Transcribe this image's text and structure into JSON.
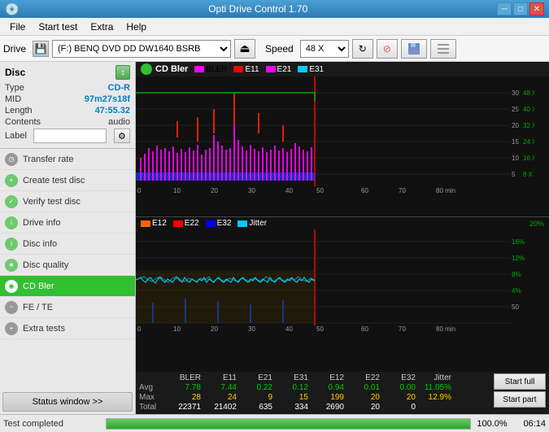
{
  "titleBar": {
    "title": "Opti Drive Control 1.70",
    "icon": "💿",
    "minBtn": "─",
    "maxBtn": "□",
    "closeBtn": "✕"
  },
  "menuBar": {
    "items": [
      "File",
      "Start test",
      "Extra",
      "Help"
    ]
  },
  "toolbar": {
    "driveLabel": "Drive",
    "driveValue": "(F:)  BENQ DVD DD DW1640 BSRB",
    "speedLabel": "Speed",
    "speedValue": "48 X"
  },
  "sidebar": {
    "discTitle": "Disc",
    "discInfo": [
      {
        "key": "Type",
        "value": "CD-R"
      },
      {
        "key": "MID",
        "value": "97m27s18f"
      },
      {
        "key": "Length",
        "value": "47:55.32"
      },
      {
        "key": "Contents",
        "value": "audio"
      },
      {
        "key": "Label",
        "value": ""
      }
    ],
    "navItems": [
      {
        "label": "Transfer rate",
        "active": false
      },
      {
        "label": "Create test disc",
        "active": false
      },
      {
        "label": "Verify test disc",
        "active": false
      },
      {
        "label": "Drive info",
        "active": false
      },
      {
        "label": "Disc info",
        "active": false
      },
      {
        "label": "Disc quality",
        "active": false
      },
      {
        "label": "CD Bler",
        "active": true
      },
      {
        "label": "FE / TE",
        "active": false
      },
      {
        "label": "Extra tests",
        "active": false
      }
    ],
    "statusWindowBtn": "Status window >>"
  },
  "chart1": {
    "title": "CD Bler",
    "legend": [
      {
        "label": "BLER",
        "color": "#ff00ff"
      },
      {
        "label": "E11",
        "color": "#ff0000"
      },
      {
        "label": "E21",
        "color": "#0000ff"
      },
      {
        "label": "E31",
        "color": "#00ccff"
      }
    ]
  },
  "chart2": {
    "legend": [
      {
        "label": "E12",
        "color": "#ff6600"
      },
      {
        "label": "E22",
        "color": "#ff0000"
      },
      {
        "label": "E32",
        "color": "#0000ff"
      },
      {
        "label": "Jitter",
        "color": "#00ccff"
      }
    ]
  },
  "stats": {
    "headers": [
      "",
      "BLER",
      "E11",
      "E21",
      "E31",
      "E12",
      "E22",
      "E32",
      "Jitter"
    ],
    "rows": [
      {
        "label": "Avg",
        "values": [
          "7.78",
          "7.44",
          "0.22",
          "0.12",
          "0.94",
          "0.01",
          "0.00",
          "11.05%"
        ]
      },
      {
        "label": "Max",
        "values": [
          "28",
          "24",
          "9",
          "15",
          "199",
          "20",
          "20",
          "12.9%"
        ]
      },
      {
        "label": "Total",
        "values": [
          "22371",
          "21402",
          "635",
          "334",
          "2690",
          "20",
          "0",
          ""
        ]
      }
    ],
    "startFull": "Start full",
    "startPart": "Start part"
  },
  "statusBar": {
    "text": "Test completed",
    "progress": 100.0,
    "progressLabel": "100.0%",
    "time": "06:14"
  },
  "colors": {
    "green": "#30c030",
    "blue": "#2d7ab5",
    "dark": "#1a1a1a"
  }
}
